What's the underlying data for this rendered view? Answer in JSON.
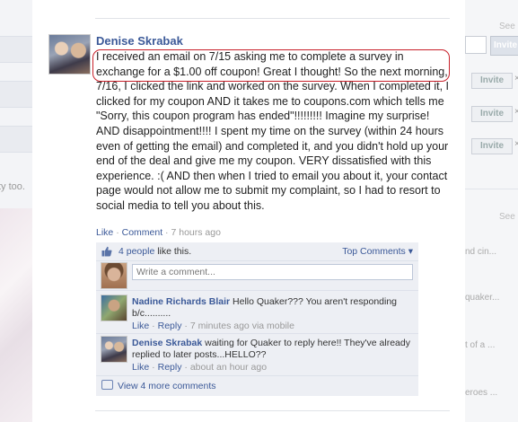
{
  "background_left": {
    "fragment": "ty too."
  },
  "background_right": {
    "see_1": "See",
    "see_2": "See",
    "invite_label": "Invite",
    "close": "×",
    "fragments": [
      "nd cin...",
      "quaker...",
      "t of a ...",
      "eroes ..."
    ]
  },
  "post": {
    "author": "Denise Skrabak",
    "body": "I received an email on 7/15 asking me to complete a survey in exchange for a $1.00 off coupon! Great I thought! So the next morning, 7/16, I clicked the link and worked on the survey. When I completed it, I clicked for my coupon AND it takes me to coupons.com which tells me \"Sorry, this coupon program has ended\"!!!!!!!!! Imagine my surprise! AND disappointment!!!! I spent my time on the survey (within 24 hours even of getting the email) and completed it, and you didn't hold up your end of the deal and give me my coupon. VERY dissatisfied with this experience. :( AND then when I tried to email you about it, your contact page would not allow me to submit my complaint, so I had to resort to social media to tell you about this.",
    "like_label": "Like",
    "comment_label": "Comment",
    "separator": "·",
    "time": "7 hours ago"
  },
  "feedback": {
    "likes_link": "4 people",
    "likes_suffix": " like this.",
    "top_comments": "Top Comments ▾",
    "write_placeholder": "Write a comment...",
    "comments": [
      {
        "author": "Nadine Richards Blair",
        "text": " Hello Quaker??? You aren't responding b/c..........",
        "like": "Like",
        "reply": "Reply",
        "time": "7 minutes ago via mobile"
      },
      {
        "author": "Denise Skrabak",
        "text": " waiting for Quaker to reply here!! They've already replied to later posts...HELLO??",
        "like": "Like",
        "reply": "Reply",
        "time": "about an hour ago"
      }
    ],
    "view_more": "View 4 more comments"
  },
  "colors": {
    "link": "#3b5998",
    "highlight": "#c8202a",
    "feedback_bg": "#edeff4"
  }
}
